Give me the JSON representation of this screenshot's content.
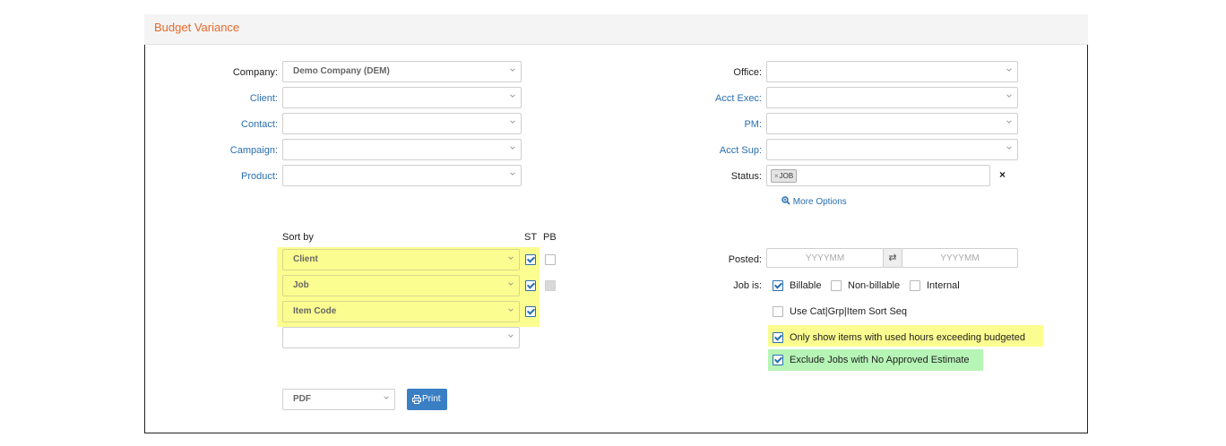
{
  "panel": {
    "title": "Budget Variance"
  },
  "left_fields": [
    {
      "label": "Company:",
      "value": "Demo Company (DEM)"
    },
    {
      "label": "Client:",
      "value": ""
    },
    {
      "label": "Contact:",
      "value": ""
    },
    {
      "label": "Campaign:",
      "value": ""
    },
    {
      "label": "Product:",
      "value": ""
    }
  ],
  "right_fields": [
    {
      "label": "Office:",
      "value": ""
    },
    {
      "label": "Acct Exec:",
      "value": ""
    },
    {
      "label": "PM:",
      "value": ""
    },
    {
      "label": "Acct Sup:",
      "value": ""
    }
  ],
  "status": {
    "label": "Status:",
    "tag": "JOB",
    "tag_remove": "×",
    "clear": "×"
  },
  "more_options": "More Options",
  "sort": {
    "title": "Sort by",
    "st_header": "ST",
    "pb_header": "PB",
    "rows": [
      {
        "value": "Client",
        "st": true,
        "pb": false
      },
      {
        "value": "Job",
        "st": true,
        "pb": false
      },
      {
        "value": "Item Code",
        "st": true
      },
      {
        "value": ""
      }
    ]
  },
  "posted": {
    "label": "Posted:",
    "from_placeholder": "YYYYMM",
    "to_placeholder": "YYYYMM",
    "swap_icon": "⇄"
  },
  "job_is": {
    "label": "Job is:",
    "options": [
      {
        "label": "Billable",
        "checked": true
      },
      {
        "label": "Non-billable",
        "checked": false
      },
      {
        "label": "Internal",
        "checked": false
      }
    ]
  },
  "options": {
    "use_cat": {
      "label": "Use Cat|Grp|Item Sort Seq",
      "checked": false
    },
    "only_show": {
      "label": "Only show items with used hours exceeding budgeted",
      "checked": true
    },
    "exclude": {
      "label": "Exclude Jobs with No Approved Estimate",
      "checked": true
    }
  },
  "output": {
    "format": "PDF",
    "print_label": "Print"
  },
  "colors": {
    "title": "#e8692b",
    "link": "#2a6fb0",
    "button": "#3a7fc4",
    "highlight_yellow": "#fcfd90",
    "highlight_green": "#b6f5b6"
  }
}
